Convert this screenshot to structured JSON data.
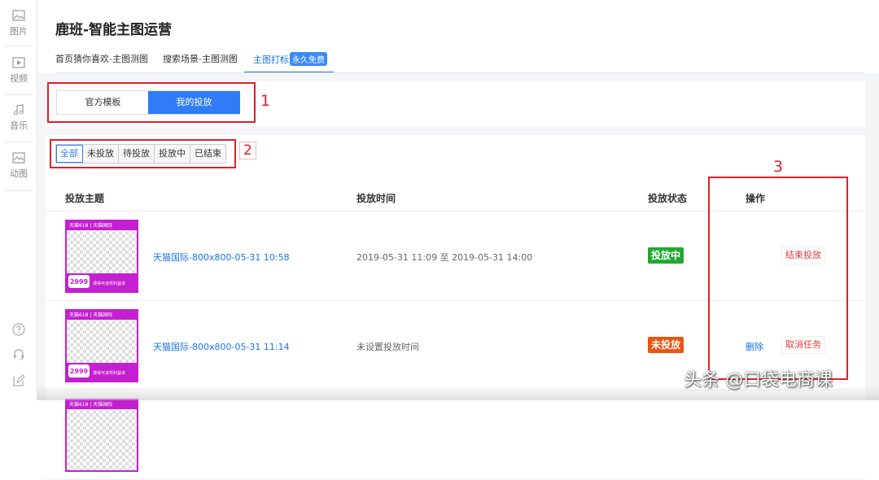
{
  "sidebar": {
    "items": [
      {
        "label": "图片",
        "icon": "image-icon"
      },
      {
        "label": "视频",
        "icon": "video-icon"
      },
      {
        "label": "音乐",
        "icon": "music-icon"
      },
      {
        "label": "动图",
        "icon": "gif-icon"
      }
    ],
    "bottom_icons": [
      "help-icon",
      "headset-icon",
      "edit-icon"
    ]
  },
  "header": {
    "title": "鹿班-智能主图运营",
    "tabs": [
      {
        "label": "首页猜你喜欢-主图测图"
      },
      {
        "label": "搜索场景-主图测图"
      },
      {
        "label": "主图打标",
        "badge": "永久免费",
        "active": true
      }
    ]
  },
  "switch": {
    "options": [
      "官方模板",
      "我的投放"
    ],
    "selected": "我的投放"
  },
  "filters": {
    "options": [
      "全部",
      "未投放",
      "待投放",
      "投放中",
      "已结束"
    ],
    "selected": "全部"
  },
  "table": {
    "columns": [
      "投放主题",
      "投放时间",
      "投放状态",
      "操作"
    ],
    "rows": [
      {
        "thumb_top": "天猫618 | 天猫国际",
        "thumb_price": "2999",
        "thumb_promo": "漫得可凌驾利益卓",
        "title": "天猫国际-800x800-05-31 10:58",
        "time": "2019-05-31 11:09 至 2019-05-31 14:00",
        "status": "投放中",
        "status_color": "#22a831",
        "actions": {
          "button": "结束投放"
        }
      },
      {
        "thumb_top": "天猫618 | 天猫国际",
        "thumb_price": "2999",
        "thumb_promo": "漫得可凌驾利益卓",
        "title": "天猫国际-800x800-05-31 11:14",
        "time": "未设置投放时间",
        "status": "未投放",
        "status_color": "#e9540f",
        "actions": {
          "link": "删除",
          "button": "取消任务"
        }
      }
    ]
  },
  "annotations": [
    "1",
    "2",
    "3"
  ],
  "watermark": "头条 @口袋电商课",
  "colors": {
    "accent": "#2f7cf6",
    "annotation": "#e0202a",
    "thumb": "#c41fd0"
  }
}
